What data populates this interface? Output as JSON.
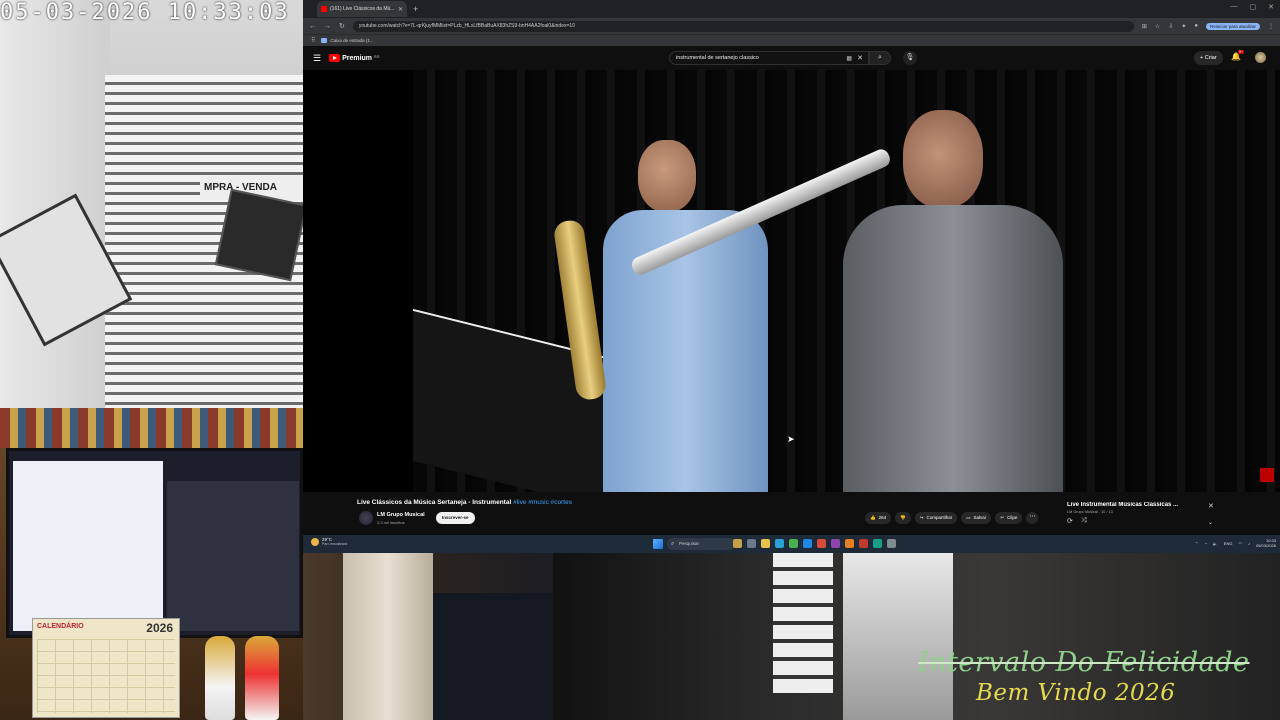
{
  "camera": {
    "timestamp": "05-03-2026 10:33:03",
    "sign_text": "MPRA - VENDA",
    "calendar_title": "CALENDÁRIO",
    "calendar_year": "2026"
  },
  "browser": {
    "tab_title": "(161) Live Clássicos da Mú...",
    "url": "youtube.com/watch?v=7L-qrKjuyfMMlist=PLzb_HLxLfBBaBuAX83hZS9-bnH4AA2foal0&index=10",
    "bookmark": "Caixa de entrada (1...",
    "update_button": "Reiniciar para atualizar"
  },
  "youtube": {
    "logo_text": "Premium",
    "logo_region": "BR",
    "search_query": "instrumental de sertanejo classico",
    "create_label": "Criar",
    "notifications": "9+",
    "video_title": "Live Clássicos da Música Sertaneja - Instrumental",
    "video_tags": "#live #music #cortes",
    "channel_name": "LM Grupo Musical",
    "subscribers": "2,3 mil inscritos",
    "subscribe_label": "Inscrever-se",
    "likes": "264",
    "share_label": "Compartilhar",
    "save_label": "Salvar",
    "clip_label": "Clipe",
    "playlist_title": "Live Instrumental Músicas Clássicas ...",
    "playlist_sub": "LM Grupo Musical - 10 / 13"
  },
  "taskbar": {
    "temperature": "29°C",
    "weather_desc": "Parc ensolarado",
    "search_label": "Pesquisar",
    "lang": "ENG",
    "time": "10:33",
    "date": "05/03/2026"
  },
  "overlay": {
    "line1": "Intervalo Do Felicidade",
    "line2": "Bem Vindo 2026"
  },
  "colors": {
    "youtube_red": "#ff0000",
    "link_blue": "#3ea6ff",
    "overlay_green": "#8fd18a",
    "overlay_yellow": "#e5d94f"
  }
}
